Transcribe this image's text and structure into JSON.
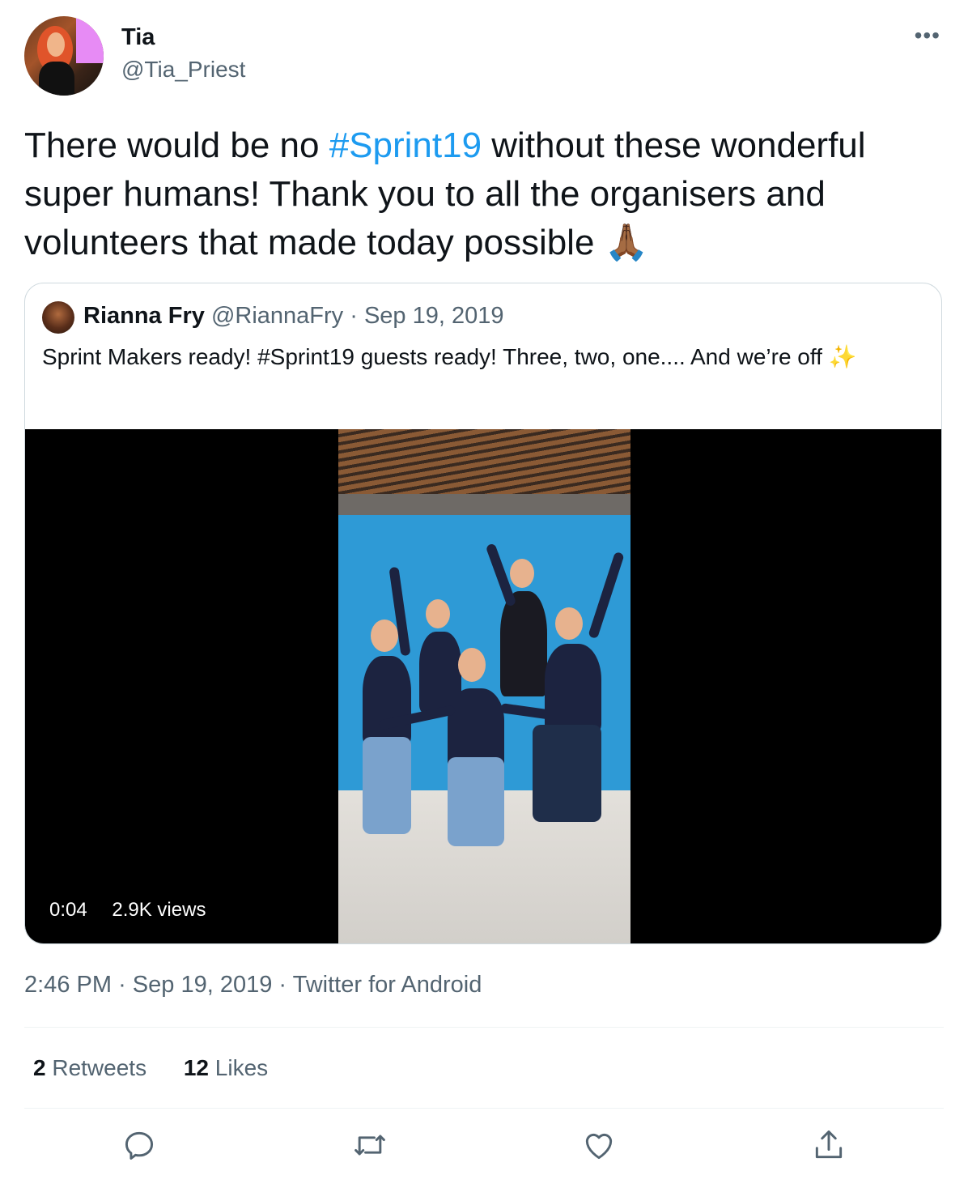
{
  "author": {
    "name": "Tia",
    "handle": "@Tia_Priest"
  },
  "more_label": "•••",
  "tweet": {
    "text_before": "There would be no ",
    "hashtag": "#Sprint19",
    "text_after": " without these wonderful super humans! Thank you to all the organisers and volunteers that made today possible ",
    "emoji": "🙏🏾"
  },
  "quoted": {
    "name": "Rianna Fry",
    "handle": "@RiannaFry",
    "separator": "·",
    "date": "Sep 19, 2019",
    "text": "Sprint Makers ready! #Sprint19 guests ready! Three, two, one.... And we’re off ✨",
    "video": {
      "duration": "0:04",
      "views": "2.9K views"
    }
  },
  "meta": {
    "time": "2:46 PM",
    "sep1": "·",
    "date": "Sep 19, 2019",
    "sep2": "·",
    "source": "Twitter for Android"
  },
  "stats": {
    "retweets_count": "2",
    "retweets_label": "Retweets",
    "likes_count": "12",
    "likes_label": "Likes"
  },
  "actions": [
    "reply-icon",
    "retweet-icon",
    "like-icon",
    "share-icon"
  ],
  "colors": {
    "link": "#1d9bf0",
    "secondary_text": "#536471",
    "primary_text": "#0f1419",
    "border": "#cfd9de"
  }
}
